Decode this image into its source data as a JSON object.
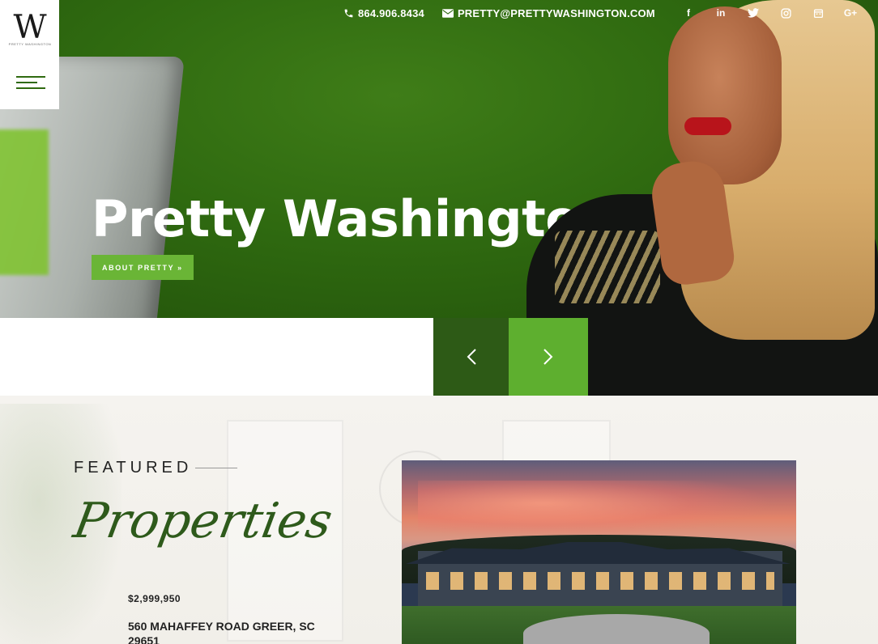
{
  "header": {
    "phone": "864.906.8434",
    "email": "PRETTY@PRETTYWASHINGTON.COM",
    "social_icons": [
      "facebook-icon",
      "linkedin-icon",
      "twitter-icon",
      "instagram-icon",
      "calendar-icon",
      "google-plus-icon"
    ],
    "social_glyphs": [
      "f",
      "in",
      "",
      "",
      "",
      "G+"
    ]
  },
  "logo": {
    "monogram": "W",
    "subtitle": "PRETTY WASHINGTON"
  },
  "hero": {
    "title": "Pretty Washington",
    "cta_label": "ABOUT PRETTY »"
  },
  "slider": {
    "prev_glyph": "‹",
    "next_glyph": "›"
  },
  "featured": {
    "label": "FEATURED",
    "script_title": "Properties",
    "price": "$2,999,950",
    "address": "560 MAHAFFEY ROAD GREER, SC 29651"
  },
  "colors": {
    "hero_green": "#2f6a10",
    "accent_green": "#6ab536",
    "dark_green_button": "#2d5a16",
    "bright_green_button": "#5eaf2f",
    "script_green": "#2e5a1b"
  }
}
